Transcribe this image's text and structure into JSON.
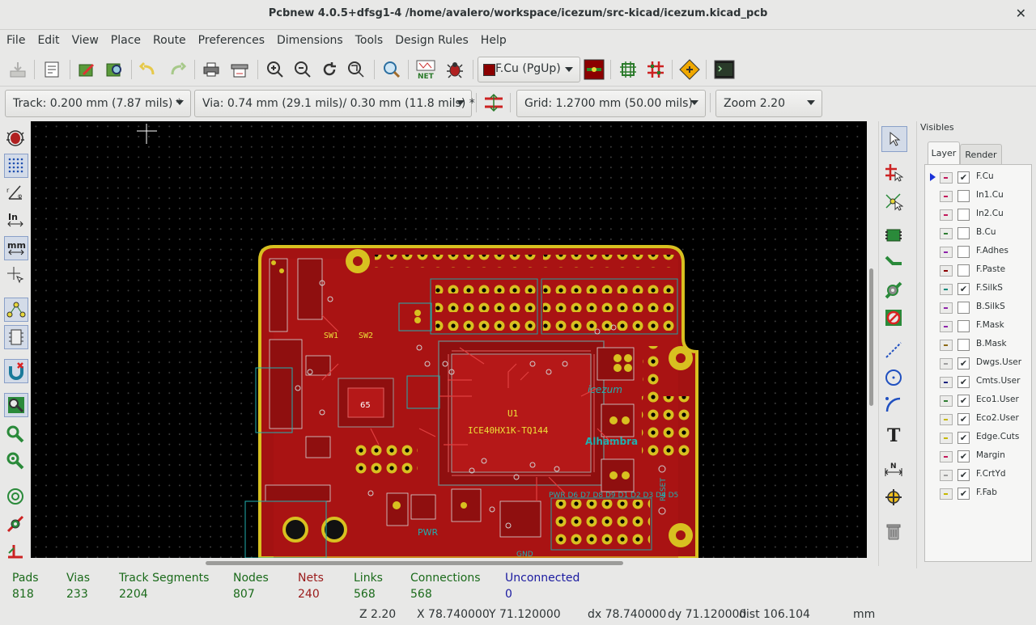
{
  "window": {
    "title": "Pcbnew 4.0.5+dfsg1-4 /home/avalero/workspace/icezum/src-kicad/icezum.kicad_pcb",
    "close_glyph": "✕"
  },
  "menu": [
    "File",
    "Edit",
    "View",
    "Place",
    "Route",
    "Preferences",
    "Dimensions",
    "Tools",
    "Design Rules",
    "Help"
  ],
  "toolbar": {
    "active_layer": "F.Cu (PgUp)",
    "layer_color": "#8b0000",
    "icons": [
      "save-board-icon",
      "page-settings-icon",
      "library-editor-icon",
      "library-browser-icon",
      "undo-icon",
      "redo-icon",
      "print-icon",
      "plot-icon",
      "zoom-in-icon",
      "zoom-out-icon",
      "redraw-icon",
      "zoom-fit-icon",
      "find-icon",
      "netlist-icon",
      "drc-icon",
      "layer-pair-icon",
      "autoplace-icon",
      "autoroute-icon",
      "microwave-icon",
      "scripting-console-icon"
    ]
  },
  "toolbar2": {
    "track": "Track: 0.200 mm (7.87 mils) *",
    "via": "Via: 0.74 mm (29.1 mils)/ 0.30 mm (11.8 mils) *",
    "grid": "Grid: 1.2700 mm (50.00 mils)",
    "zoom": "Zoom 2.20"
  },
  "board_labels": {
    "chip_ref": "U1",
    "chip_name": "ICE40HX1K-TQ144",
    "logo": "Alhambra",
    "brand": "icezum",
    "sw1": "SW1",
    "sw2": "SW2",
    "pwr": "PWR",
    "reset": "RESET",
    "gnd": "GND",
    "c65": "65",
    "bottom_silk": "PWR  D6  D7  D8  D9  D1  D2  D3  D4  D5"
  },
  "visibles": {
    "title": "Visibles",
    "tabs": [
      "Layer",
      "Render"
    ],
    "layers": [
      {
        "name": "F.Cu",
        "checked": true,
        "color": "#c2185b",
        "active": true
      },
      {
        "name": "In1.Cu",
        "checked": false,
        "color": "#c2185b",
        "active": false
      },
      {
        "name": "In2.Cu",
        "checked": false,
        "color": "#c2185b",
        "active": false
      },
      {
        "name": "B.Cu",
        "checked": false,
        "color": "#2e7d32",
        "active": false
      },
      {
        "name": "F.Adhes",
        "checked": false,
        "color": "#8e24aa",
        "active": false
      },
      {
        "name": "F.Paste",
        "checked": false,
        "color": "#8b0000",
        "active": false
      },
      {
        "name": "F.SilkS",
        "checked": true,
        "color": "#00897b",
        "active": false
      },
      {
        "name": "B.SilkS",
        "checked": false,
        "color": "#8e24aa",
        "active": false
      },
      {
        "name": "F.Mask",
        "checked": false,
        "color": "#8e24aa",
        "active": false
      },
      {
        "name": "B.Mask",
        "checked": false,
        "color": "#8b6914",
        "active": false
      },
      {
        "name": "Dwgs.User",
        "checked": true,
        "color": "#9e9e9e",
        "active": false
      },
      {
        "name": "Cmts.User",
        "checked": true,
        "color": "#1a237e",
        "active": false
      },
      {
        "name": "Eco1.User",
        "checked": true,
        "color": "#2e7d32",
        "active": false
      },
      {
        "name": "Eco2.User",
        "checked": true,
        "color": "#c6b800",
        "active": false
      },
      {
        "name": "Edge.Cuts",
        "checked": true,
        "color": "#c6b800",
        "active": false
      },
      {
        "name": "Margin",
        "checked": true,
        "color": "#c2185b",
        "active": false
      },
      {
        "name": "F.CrtYd",
        "checked": true,
        "color": "#9e9e9e",
        "active": false
      },
      {
        "name": "F.Fab",
        "checked": true,
        "color": "#c6b800",
        "active": false
      }
    ]
  },
  "status": [
    {
      "label": "Pads",
      "value": "818",
      "color": "#1a6a1a"
    },
    {
      "label": "Vias",
      "value": "233",
      "color": "#1a6a1a"
    },
    {
      "label": "Track Segments",
      "value": "2204",
      "color": "#1a6a1a"
    },
    {
      "label": "Nodes",
      "value": "807",
      "color": "#1a6a1a"
    },
    {
      "label": "Nets",
      "value": "240",
      "color": "#9a1a1a"
    },
    {
      "label": "Links",
      "value": "568",
      "color": "#1a6a1a"
    },
    {
      "label": "Connections",
      "value": "568",
      "color": "#1a6a1a"
    },
    {
      "label": "Unconnected",
      "value": "0",
      "color": "#1a1aa0"
    }
  ],
  "footer": {
    "zoom": "Z 2.20",
    "x": "X 78.740000",
    "y": "Y 71.120000",
    "dx": "dx 78.740000",
    "dy": "dy 71.120000",
    "dist": "dist 106.104",
    "units": "mm"
  }
}
